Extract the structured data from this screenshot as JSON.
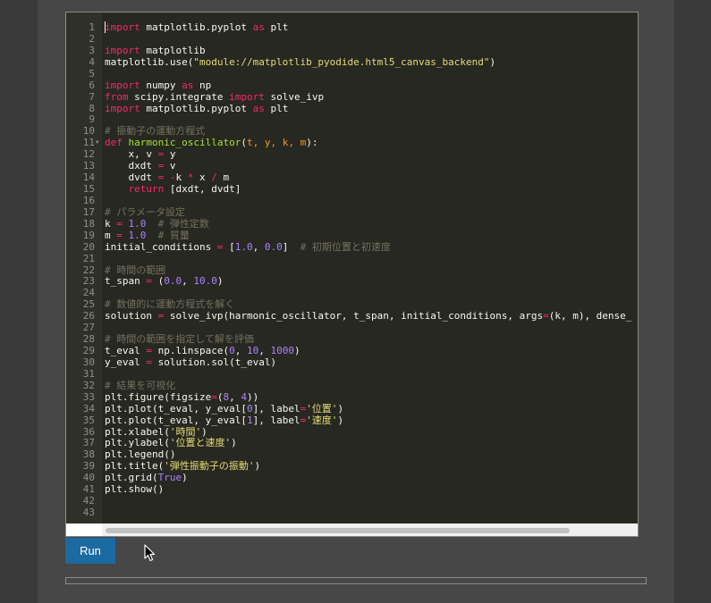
{
  "editor": {
    "lines": [
      [
        [
          "kw",
          "import"
        ],
        [
          "tx",
          " matplotlib.pyplot "
        ],
        [
          "kw",
          "as"
        ],
        [
          "tx",
          " plt"
        ]
      ],
      [],
      [
        [
          "kw",
          "import"
        ],
        [
          "tx",
          " matplotlib"
        ]
      ],
      [
        [
          "tx",
          "matplotlib.use("
        ],
        [
          "st",
          "\"module://matplotlib_pyodide.html5_canvas_backend\""
        ],
        [
          "tx",
          ")"
        ]
      ],
      [],
      [
        [
          "kw",
          "import"
        ],
        [
          "tx",
          " numpy "
        ],
        [
          "kw",
          "as"
        ],
        [
          "tx",
          " np"
        ]
      ],
      [
        [
          "kw",
          "from"
        ],
        [
          "tx",
          " scipy.integrate "
        ],
        [
          "kw",
          "import"
        ],
        [
          "tx",
          " solve_ivp"
        ]
      ],
      [
        [
          "kw",
          "import"
        ],
        [
          "tx",
          " matplotlib.pyplot "
        ],
        [
          "kw",
          "as"
        ],
        [
          "tx",
          " plt"
        ]
      ],
      [],
      [
        [
          "cm",
          "# 振動子の運動方程式"
        ]
      ],
      [
        [
          "kw",
          "def"
        ],
        [
          "tx",
          " "
        ],
        [
          "fn",
          "harmonic_oscillator"
        ],
        [
          "tx",
          "("
        ],
        [
          "pa",
          "t, y, k, m"
        ],
        [
          "tx",
          "):"
        ]
      ],
      [
        [
          "tx",
          "    x, v "
        ],
        [
          "kw",
          "="
        ],
        [
          "tx",
          " y"
        ]
      ],
      [
        [
          "tx",
          "    dxdt "
        ],
        [
          "kw",
          "="
        ],
        [
          "tx",
          " v"
        ]
      ],
      [
        [
          "tx",
          "    dvdt "
        ],
        [
          "kw",
          "="
        ],
        [
          "tx",
          " "
        ],
        [
          "kw",
          "-"
        ],
        [
          "tx",
          "k "
        ],
        [
          "kw",
          "*"
        ],
        [
          "tx",
          " x "
        ],
        [
          "kw",
          "/"
        ],
        [
          "tx",
          " m"
        ]
      ],
      [
        [
          "tx",
          "    "
        ],
        [
          "kw",
          "return"
        ],
        [
          "tx",
          " [dxdt, dvdt]"
        ]
      ],
      [],
      [
        [
          "cm",
          "# パラメータ設定"
        ]
      ],
      [
        [
          "tx",
          "k "
        ],
        [
          "kw",
          "="
        ],
        [
          "tx",
          " "
        ],
        [
          "nu",
          "1.0"
        ],
        [
          "tx",
          "  "
        ],
        [
          "cm",
          "# 弾性定数"
        ]
      ],
      [
        [
          "tx",
          "m "
        ],
        [
          "kw",
          "="
        ],
        [
          "tx",
          " "
        ],
        [
          "nu",
          "1.0"
        ],
        [
          "tx",
          "  "
        ],
        [
          "cm",
          "# 質量"
        ]
      ],
      [
        [
          "tx",
          "initial_conditions "
        ],
        [
          "kw",
          "="
        ],
        [
          "tx",
          " ["
        ],
        [
          "nu",
          "1.0"
        ],
        [
          "tx",
          ", "
        ],
        [
          "nu",
          "0.0"
        ],
        [
          "tx",
          "]  "
        ],
        [
          "cm",
          "# 初期位置と初速度"
        ]
      ],
      [],
      [
        [
          "cm",
          "# 時間の範囲"
        ]
      ],
      [
        [
          "tx",
          "t_span "
        ],
        [
          "kw",
          "="
        ],
        [
          "tx",
          " ("
        ],
        [
          "nu",
          "0.0"
        ],
        [
          "tx",
          ", "
        ],
        [
          "nu",
          "10.0"
        ],
        [
          "tx",
          ")"
        ]
      ],
      [],
      [
        [
          "cm",
          "# 数値的に運動方程式を解く"
        ]
      ],
      [
        [
          "tx",
          "solution "
        ],
        [
          "kw",
          "="
        ],
        [
          "tx",
          " solve_ivp(harmonic_oscillator, t_span, initial_conditions, args"
        ],
        [
          "kw",
          "="
        ],
        [
          "tx",
          "(k, m), dense_"
        ]
      ],
      [],
      [
        [
          "cm",
          "# 時間の範囲を指定して解を評価"
        ]
      ],
      [
        [
          "tx",
          "t_eval "
        ],
        [
          "kw",
          "="
        ],
        [
          "tx",
          " np.linspace("
        ],
        [
          "nu",
          "0"
        ],
        [
          "tx",
          ", "
        ],
        [
          "nu",
          "10"
        ],
        [
          "tx",
          ", "
        ],
        [
          "nu",
          "1000"
        ],
        [
          "tx",
          ")"
        ]
      ],
      [
        [
          "tx",
          "y_eval "
        ],
        [
          "kw",
          "="
        ],
        [
          "tx",
          " solution.sol(t_eval)"
        ]
      ],
      [],
      [
        [
          "cm",
          "# 結果を可視化"
        ]
      ],
      [
        [
          "tx",
          "plt.figure(figsize"
        ],
        [
          "kw",
          "="
        ],
        [
          "tx",
          "("
        ],
        [
          "nu",
          "8"
        ],
        [
          "tx",
          ", "
        ],
        [
          "nu",
          "4"
        ],
        [
          "tx",
          "))"
        ]
      ],
      [
        [
          "tx",
          "plt.plot(t_eval, y_eval["
        ],
        [
          "nu",
          "0"
        ],
        [
          "tx",
          "], label"
        ],
        [
          "kw",
          "="
        ],
        [
          "st",
          "'位置'"
        ],
        [
          "tx",
          ")"
        ]
      ],
      [
        [
          "tx",
          "plt.plot(t_eval, y_eval["
        ],
        [
          "nu",
          "1"
        ],
        [
          "tx",
          "], label"
        ],
        [
          "kw",
          "="
        ],
        [
          "st",
          "'速度'"
        ],
        [
          "tx",
          ")"
        ]
      ],
      [
        [
          "tx",
          "plt.xlabel("
        ],
        [
          "st",
          "'時間'"
        ],
        [
          "tx",
          ")"
        ]
      ],
      [
        [
          "tx",
          "plt.ylabel("
        ],
        [
          "st",
          "'位置と速度'"
        ],
        [
          "tx",
          ")"
        ]
      ],
      [
        [
          "tx",
          "plt.legend()"
        ]
      ],
      [
        [
          "tx",
          "plt.title("
        ],
        [
          "st",
          "'弾性振動子の振動'"
        ],
        [
          "tx",
          ")"
        ]
      ],
      [
        [
          "tx",
          "plt.grid("
        ],
        [
          "nu",
          "True"
        ],
        [
          "tx",
          ")"
        ]
      ],
      [
        [
          "tx",
          "plt.show()"
        ]
      ],
      [],
      []
    ],
    "fold_marker_line": 11,
    "fold_marker_glyph": "▾"
  },
  "run_button": {
    "label": "Run"
  },
  "colors": {
    "kw": "#f92672",
    "st": "#e6db74",
    "cm": "#75715e",
    "nu": "#ae81ff",
    "fn": "#a6e22e",
    "pa": "#fd971f",
    "tx": "#f8f8f2",
    "run_button": "#1c6aa2"
  }
}
